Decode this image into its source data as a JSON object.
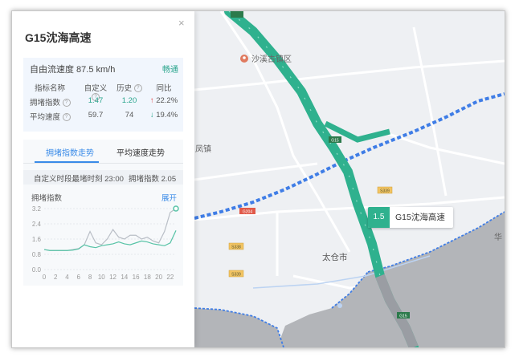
{
  "panel": {
    "title": "G15沈海高速",
    "close_glyph": "×",
    "free_flow": "自由流速度 87.5 km/h",
    "status": "畅通",
    "table": {
      "headers": [
        "指标名称",
        "自定义",
        "历史",
        "同比"
      ],
      "rows": [
        {
          "name": "拥堵指数",
          "custom": "1.47",
          "history": "1.20",
          "trend": "up",
          "yoy": "22.2%"
        },
        {
          "name": "平均速度",
          "custom": "59.7",
          "history": "74",
          "trend": "down",
          "yoy": "19.4%"
        }
      ]
    },
    "tabs": [
      "拥堵指数走势",
      "平均速度走势"
    ],
    "peak_time": "自定义时段最堵时刻 23:00",
    "peak_index": "拥堵指数 2.05",
    "chart_label": "拥堵指数",
    "expand": "展开"
  },
  "chart_data": {
    "type": "line",
    "x": [
      0,
      1,
      2,
      3,
      4,
      5,
      6,
      7,
      8,
      9,
      10,
      11,
      12,
      13,
      14,
      15,
      16,
      17,
      18,
      19,
      20,
      21,
      22,
      23
    ],
    "xticks": [
      "0",
      "2",
      "4",
      "6",
      "8",
      "10",
      "12",
      "14",
      "16",
      "18",
      "20",
      "22"
    ],
    "yticks": [
      "0.0",
      "0.8",
      "1.6",
      "2.4",
      "3.2"
    ],
    "ylim": [
      0,
      3.2
    ],
    "series": [
      {
        "color": "#57c3a6",
        "values": [
          1.05,
          1.0,
          1.0,
          1.0,
          1.0,
          1.02,
          1.08,
          1.3,
          1.2,
          1.15,
          1.25,
          1.3,
          1.35,
          1.45,
          1.35,
          1.3,
          1.4,
          1.5,
          1.45,
          1.35,
          1.3,
          1.25,
          1.4,
          2.05
        ]
      },
      {
        "color": "#b9bec6",
        "values": [
          1.05,
          1.0,
          1.0,
          1.0,
          1.0,
          1.05,
          1.1,
          1.3,
          2.0,
          1.4,
          1.3,
          1.6,
          2.1,
          1.7,
          1.6,
          1.8,
          1.8,
          1.6,
          1.7,
          1.5,
          1.4,
          2.0,
          3.0,
          3.2
        ]
      }
    ]
  },
  "map": {
    "labels": {
      "district": "沙溪古镇区",
      "town": "凤镇",
      "city": "太仓市",
      "hua": "华"
    },
    "shields": [
      "G15",
      "G204",
      "S339",
      "S339",
      "S338",
      "G15"
    ],
    "highway_badge": {
      "value": "1.5",
      "name": "G15沈海高速"
    },
    "colors": {
      "highway": "#2fb18e",
      "highway_dark": "#55bfa3",
      "boundary": "#3f7de6",
      "urban": "#b3b5b9"
    }
  }
}
